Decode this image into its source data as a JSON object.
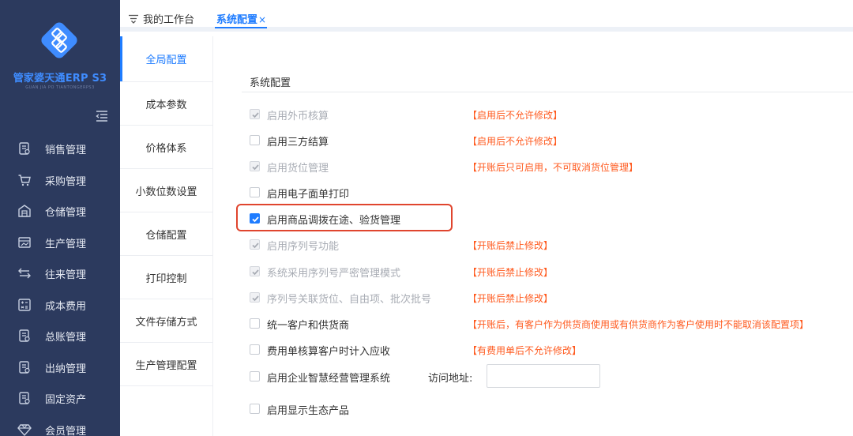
{
  "app": {
    "name": "管家婆天通ERP S3",
    "subtitle": "GUAN JIA PO TIANTONGERPS3"
  },
  "tabs": {
    "home": "我的工作台",
    "active": "系统配置",
    "close_symbol": "×"
  },
  "sidebar": {
    "items": [
      {
        "label": "销售管理",
        "icon": "document-icon"
      },
      {
        "label": "采购管理",
        "icon": "cart-icon"
      },
      {
        "label": "仓储管理",
        "icon": "warehouse-icon"
      },
      {
        "label": "生产管理",
        "icon": "factory-icon"
      },
      {
        "label": "往来管理",
        "icon": "exchange-icon"
      },
      {
        "label": "成本费用",
        "icon": "cost-icon"
      },
      {
        "label": "总账管理",
        "icon": "ledger-icon"
      },
      {
        "label": "出纳管理",
        "icon": "cashier-icon"
      },
      {
        "label": "固定资产",
        "icon": "asset-icon"
      },
      {
        "label": "会员管理",
        "icon": "diamond-icon"
      }
    ]
  },
  "subnav": {
    "items": [
      "全局配置",
      "成本参数",
      "价格体系",
      "小数位数设置",
      "仓储配置",
      "打印控制",
      "文件存储方式",
      "生产管理配置"
    ],
    "active_index": 0
  },
  "section": {
    "title": "系统配置"
  },
  "settings": [
    {
      "label": "启用外币核算",
      "state": "checked-disabled",
      "note": "【启用后不允许修改】"
    },
    {
      "label": "启用三方结算",
      "state": "unchecked",
      "note": "【启用后不允许修改】"
    },
    {
      "label": "启用货位管理",
      "state": "checked-disabled",
      "note": "【开账后只可启用，不可取消货位管理】"
    },
    {
      "label": "启用电子面单打印",
      "state": "unchecked",
      "note": ""
    },
    {
      "label": "启用商品调拨在途、验货管理",
      "state": "checked-active",
      "note": ""
    },
    {
      "label": "启用序列号功能",
      "state": "checked-disabled",
      "note": "【开账后禁止修改】"
    },
    {
      "label": "系统采用序列号严密管理模式",
      "state": "checked-disabled",
      "note": "【开账后禁止修改】"
    },
    {
      "label": "序列号关联货位、自由项、批次批号",
      "state": "checked-disabled",
      "note": "【开账后禁止修改】"
    },
    {
      "label": "统一客户和供货商",
      "state": "unchecked",
      "note": "【开账后，有客户作为供货商使用或有供货商作为客户使用时不能取消该配置项】"
    },
    {
      "label": "费用单核算客户时计入应收",
      "state": "unchecked",
      "note": "【有费用单后不允许修改】"
    },
    {
      "label": "启用企业智慧经营管理系统",
      "state": "unchecked",
      "note": ""
    },
    {
      "label": "启用显示生态产品",
      "state": "unchecked",
      "note": ""
    }
  ],
  "access_address": {
    "label": "访问地址:",
    "value": ""
  },
  "colors": {
    "sidebar_bg": "#2c3a5e",
    "accent": "#1e7cff",
    "warning": "#ff5a1f",
    "highlight": "#e0452e"
  }
}
